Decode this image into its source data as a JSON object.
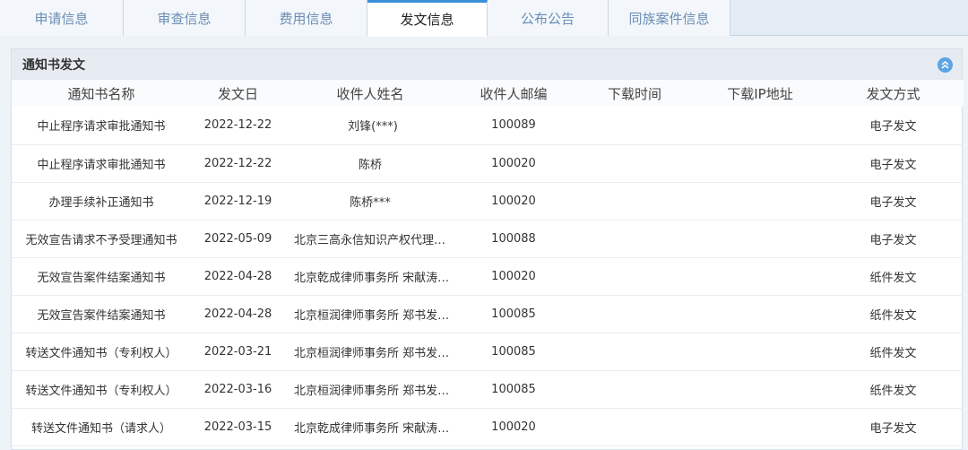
{
  "tabs": [
    {
      "label": "申请信息"
    },
    {
      "label": "审查信息"
    },
    {
      "label": "费用信息"
    },
    {
      "label": "发文信息"
    },
    {
      "label": "公布公告"
    },
    {
      "label": "同族案件信息"
    }
  ],
  "panel": {
    "title": "通知书发文",
    "collapse_icon": "chevron-double-up-icon"
  },
  "table": {
    "headers": [
      "通知书名称",
      "发文日",
      "收件人姓名",
      "收件人邮编",
      "下载时间",
      "下载IP地址",
      "发文方式"
    ],
    "rows": [
      [
        "中止程序请求审批通知书",
        "2022-12-22",
        "刘锋(***)",
        "100089",
        "",
        "",
        "电子发文"
      ],
      [
        "中止程序请求审批通知书",
        "2022-12-22",
        "陈桥",
        "100020",
        "",
        "",
        "电子发文"
      ],
      [
        "办理手续补正通知书",
        "2022-12-19",
        "陈桥***",
        "100020",
        "",
        "",
        "电子发文"
      ],
      [
        "无效宣告请求不予受理通知书",
        "2022-05-09",
        "北京三高永信知识产权代理有...",
        "100088",
        "",
        "",
        "电子发文"
      ],
      [
        "无效宣告案件结案通知书",
        "2022-04-28",
        "北京乾成律师事务所 宋献涛 ...",
        "100020",
        "",
        "",
        "纸件发文"
      ],
      [
        "无效宣告案件结案通知书",
        "2022-04-28",
        "北京桓润律师事务所 郑书发(*...",
        "100085",
        "",
        "",
        "纸件发文"
      ],
      [
        "转送文件通知书（专利权人）",
        "2022-03-21",
        "北京桓润律师事务所 郑书发(*...",
        "100085",
        "",
        "",
        "纸件发文"
      ],
      [
        "转送文件通知书（专利权人）",
        "2022-03-16",
        "北京桓润律师事务所 郑书发(*...",
        "100085",
        "",
        "",
        "纸件发文"
      ],
      [
        "转送文件通知书（请求人）",
        "2022-03-15",
        "北京乾成律师事务所 宋献涛 ...",
        "100020",
        "",
        "",
        "电子发文"
      ]
    ]
  }
}
